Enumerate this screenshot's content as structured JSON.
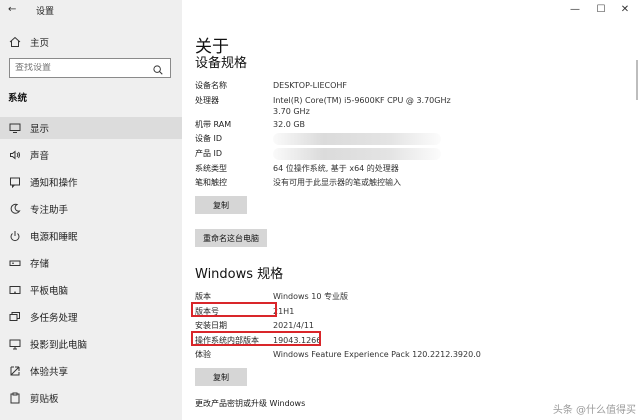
{
  "window": {
    "title": "设置"
  },
  "sidebar": {
    "home": "主页",
    "search_placeholder": "查找设置",
    "section": "系统",
    "items": [
      {
        "label": "显示",
        "icon": "display-icon",
        "active": true
      },
      {
        "label": "声音",
        "icon": "speaker-icon",
        "active": false
      },
      {
        "label": "通知和操作",
        "icon": "notification-icon",
        "active": false
      },
      {
        "label": "专注助手",
        "icon": "moon-icon",
        "active": false
      },
      {
        "label": "电源和睡眠",
        "icon": "power-icon",
        "active": false
      },
      {
        "label": "存储",
        "icon": "storage-icon",
        "active": false
      },
      {
        "label": "平板电脑",
        "icon": "tablet-icon",
        "active": false
      },
      {
        "label": "多任务处理",
        "icon": "multitask-icon",
        "active": false
      },
      {
        "label": "投影到此电脑",
        "icon": "project-icon",
        "active": false
      },
      {
        "label": "体验共享",
        "icon": "share-icon",
        "active": false
      },
      {
        "label": "剪贴板",
        "icon": "clipboard-icon",
        "active": false
      }
    ]
  },
  "main": {
    "title": "关于",
    "device_specs": {
      "heading": "设备规格",
      "rows": [
        {
          "key": "设备名称",
          "value": "DESKTOP-LIECOHF"
        },
        {
          "key": "处理器",
          "value": "Intel(R) Core(TM) i5-9600KF CPU @ 3.70GHz   3.70 GHz"
        },
        {
          "key": "机带 RAM",
          "value": "32.0 GB"
        },
        {
          "key": "设备 ID",
          "value": ""
        },
        {
          "key": "产品 ID",
          "value": ""
        },
        {
          "key": "系统类型",
          "value": "64 位操作系统, 基于 x64 的处理器"
        },
        {
          "key": "笔和触控",
          "value": "没有可用于此显示器的笔或触控输入"
        }
      ],
      "copy_button": "复制",
      "rename_button": "重命名这台电脑"
    },
    "windows_specs": {
      "heading": "Windows 规格",
      "rows": [
        {
          "key": "版本",
          "value": "Windows 10 专业版"
        },
        {
          "key": "版本号",
          "value": "21H1"
        },
        {
          "key": "安装日期",
          "value": "2021/4/11"
        },
        {
          "key": "操作系统内部版本",
          "value": "19043.1266"
        },
        {
          "key": "体验",
          "value": "Windows Feature Experience Pack 120.2212.3920.0"
        }
      ],
      "copy_button": "复制",
      "link": "更改产品密钥或升级 Windows"
    }
  },
  "watermark": "头条 @什么值得买",
  "colors": {
    "highlight": "#d9262a",
    "sidebar_bg": "#efefef",
    "button_bg": "#d6d6d6"
  }
}
